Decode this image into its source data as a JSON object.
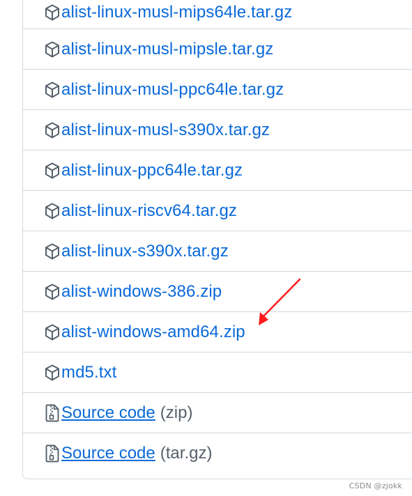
{
  "assets": [
    {
      "name": "alist-linux-musl-mips64le.tar.gz",
      "icon": "package-icon"
    },
    {
      "name": "alist-linux-musl-mipsle.tar.gz",
      "icon": "package-icon"
    },
    {
      "name": "alist-linux-musl-ppc64le.tar.gz",
      "icon": "package-icon"
    },
    {
      "name": "alist-linux-musl-s390x.tar.gz",
      "icon": "package-icon"
    },
    {
      "name": "alist-linux-ppc64le.tar.gz",
      "icon": "package-icon"
    },
    {
      "name": "alist-linux-riscv64.tar.gz",
      "icon": "package-icon"
    },
    {
      "name": "alist-linux-s390x.tar.gz",
      "icon": "package-icon"
    },
    {
      "name": "alist-windows-386.zip",
      "icon": "package-icon"
    },
    {
      "name": "alist-windows-amd64.zip",
      "icon": "package-icon"
    },
    {
      "name": "md5.txt",
      "icon": "package-icon"
    }
  ],
  "source_code": [
    {
      "label": "Source code",
      "suffix": "(zip)",
      "icon": "file-zip-icon"
    },
    {
      "label": "Source code",
      "suffix": "(tar.gz)",
      "icon": "file-zip-icon"
    }
  ],
  "colors": {
    "link": "#0969da",
    "muted": "#57606a",
    "border": "#d0d7de",
    "icon": "#57606a",
    "annotation_arrow": "#ff1a1a"
  },
  "watermark": "CSDN @zjokk"
}
